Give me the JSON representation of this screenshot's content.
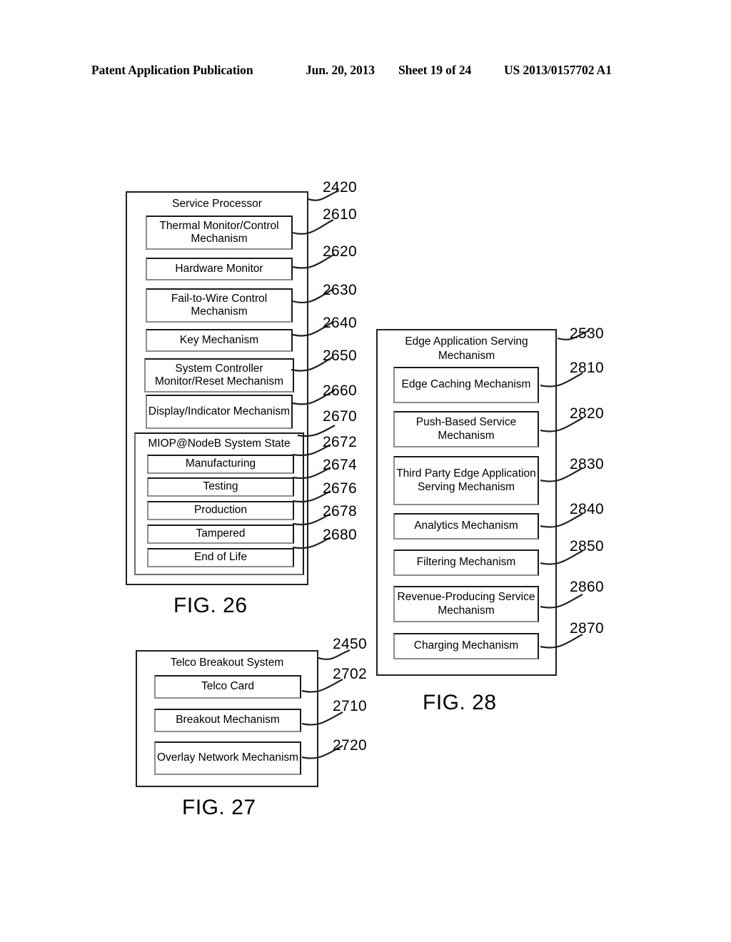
{
  "header": {
    "publication": "Patent Application Publication",
    "date": "Jun. 20, 2013",
    "sheet": "Sheet 19 of 24",
    "patent_number": "US 2013/0157702 A1"
  },
  "figures": [
    {
      "id": "fig26",
      "caption": "FIG. 26",
      "title": "Service Processor",
      "title_ref": "2420",
      "blocks": [
        {
          "label": "Thermal Monitor/Control Mechanism",
          "ref": "2610"
        },
        {
          "label": "Hardware Monitor",
          "ref": "2620"
        },
        {
          "label": "Fail-to-Wire Control Mechanism",
          "ref": "2630"
        },
        {
          "label": "Key Mechanism",
          "ref": "2640"
        },
        {
          "label": "System Controller Monitor/Reset Mechanism",
          "ref": "2650"
        },
        {
          "label": "Display/Indicator Mechanism",
          "ref": "2660"
        }
      ],
      "nested": {
        "title": "MIOP@NodeB System State",
        "ref": "2670",
        "blocks": [
          {
            "label": "Manufacturing",
            "ref": "2672"
          },
          {
            "label": "Testing",
            "ref": "2674"
          },
          {
            "label": "Production",
            "ref": "2676"
          },
          {
            "label": "Tampered",
            "ref": "2678"
          },
          {
            "label": "End of Life",
            "ref": "2680"
          }
        ]
      }
    },
    {
      "id": "fig27",
      "caption": "FIG. 27",
      "title": "Telco Breakout System",
      "title_ref": "2450",
      "blocks": [
        {
          "label": "Telco Card",
          "ref": "2702"
        },
        {
          "label": "Breakout Mechanism",
          "ref": "2710"
        },
        {
          "label": "Overlay Network Mechanism",
          "ref": "2720"
        }
      ]
    },
    {
      "id": "fig28",
      "caption": "FIG. 28",
      "title": "Edge Application Serving Mechanism",
      "title_ref": "2530",
      "blocks": [
        {
          "label": "Edge Caching Mechanism",
          "ref": "2810"
        },
        {
          "label": "Push-Based Service Mechanism",
          "ref": "2820"
        },
        {
          "label": "Third Party Edge Application Serving Mechanism",
          "ref": "2830"
        },
        {
          "label": "Analytics Mechanism",
          "ref": "2840"
        },
        {
          "label": "Filtering Mechanism",
          "ref": "2850"
        },
        {
          "label": "Revenue-Producing Service Mechanism",
          "ref": "2860"
        },
        {
          "label": "Charging Mechanism",
          "ref": "2870"
        }
      ]
    }
  ],
  "colors": {
    "ink": "#231f20",
    "page": "#ffffff"
  }
}
